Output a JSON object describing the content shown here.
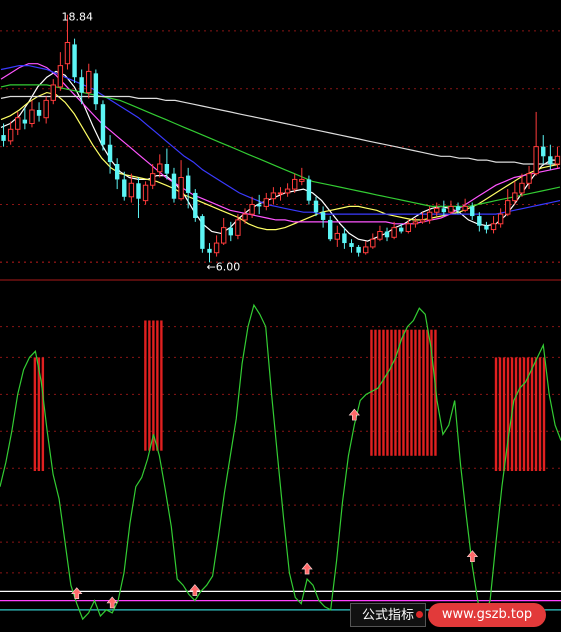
{
  "chart_data": [
    {
      "type": "candlestick",
      "annotations": {
        "high": "18.84",
        "low": "←6.00"
      },
      "price_range": [
        5.5,
        19.5
      ],
      "candles": [
        [
          12.6,
          12.3,
          13.2,
          12.0
        ],
        [
          12.3,
          12.9,
          13.3,
          12.1
        ],
        [
          12.9,
          13.5,
          13.8,
          12.6
        ],
        [
          13.4,
          13.2,
          14.0,
          12.9
        ],
        [
          13.2,
          13.9,
          14.4,
          13.0
        ],
        [
          13.9,
          13.6,
          14.3,
          13.3
        ],
        [
          13.5,
          14.4,
          14.6,
          13.2
        ],
        [
          14.4,
          15.2,
          15.5,
          14.2
        ],
        [
          15.1,
          16.2,
          16.9,
          14.9
        ],
        [
          16.3,
          17.4,
          18.84,
          16.0
        ],
        [
          17.3,
          15.6,
          17.6,
          15.3
        ],
        [
          15.6,
          14.8,
          16.0,
          14.2
        ],
        [
          14.8,
          15.9,
          16.3,
          14.5
        ],
        [
          15.8,
          14.2,
          16.0,
          13.9
        ],
        [
          14.2,
          12.1,
          14.4,
          11.8
        ],
        [
          12.1,
          11.2,
          12.6,
          10.6
        ],
        [
          11.1,
          10.3,
          11.4,
          9.8
        ],
        [
          10.3,
          9.4,
          10.7,
          9.2
        ],
        [
          9.4,
          10.1,
          10.6,
          9.1
        ],
        [
          10.1,
          9.3,
          10.4,
          8.3
        ],
        [
          9.2,
          10.0,
          10.2,
          9.0
        ],
        [
          10.0,
          10.6,
          11.1,
          9.8
        ],
        [
          10.7,
          11.1,
          11.6,
          10.4
        ],
        [
          11.1,
          10.6,
          11.9,
          10.3
        ],
        [
          10.6,
          9.3,
          10.9,
          9.1
        ],
        [
          9.3,
          10.4,
          11.3,
          9.2
        ],
        [
          10.5,
          9.6,
          10.9,
          8.8
        ],
        [
          9.6,
          8.3,
          9.8,
          8.1
        ],
        [
          8.4,
          6.7,
          8.5,
          6.5
        ],
        [
          6.7,
          6.5,
          7.0,
          6.0
        ],
        [
          6.5,
          7.0,
          7.4,
          6.3
        ],
        [
          7.0,
          7.8,
          8.3,
          6.9
        ],
        [
          7.8,
          7.4,
          8.1,
          7.1
        ],
        [
          7.4,
          8.2,
          8.5,
          7.2
        ],
        [
          8.2,
          8.5,
          8.8,
          8.0
        ],
        [
          8.5,
          9.0,
          9.4,
          8.3
        ],
        [
          9.0,
          8.9,
          9.5,
          8.5
        ],
        [
          8.9,
          9.3,
          9.6,
          8.7
        ],
        [
          9.3,
          9.6,
          9.9,
          9.0
        ],
        [
          9.6,
          9.6,
          9.9,
          9.2
        ],
        [
          9.6,
          9.8,
          10.1,
          9.4
        ],
        [
          9.8,
          10.3,
          10.6,
          9.6
        ],
        [
          10.2,
          10.3,
          10.9,
          10.0
        ],
        [
          10.3,
          9.2,
          10.5,
          9.0
        ],
        [
          9.2,
          8.6,
          9.4,
          8.4
        ],
        [
          8.6,
          8.2,
          8.9,
          7.8
        ],
        [
          8.2,
          7.2,
          8.4,
          7.1
        ],
        [
          7.2,
          7.5,
          7.9,
          6.8
        ],
        [
          7.5,
          7.0,
          7.8,
          6.7
        ],
        [
          7.0,
          6.8,
          7.2,
          6.5
        ],
        [
          6.8,
          6.5,
          6.9,
          6.3
        ],
        [
          6.5,
          6.8,
          7.1,
          6.4
        ],
        [
          6.8,
          7.2,
          7.5,
          6.7
        ],
        [
          7.2,
          7.6,
          7.9,
          7.1
        ],
        [
          7.6,
          7.3,
          7.8,
          7.1
        ],
        [
          7.3,
          7.8,
          8.1,
          7.2
        ],
        [
          7.8,
          7.6,
          8.0,
          7.5
        ],
        [
          7.6,
          8.0,
          8.2,
          7.5
        ],
        [
          8.0,
          8.1,
          8.3,
          7.8
        ],
        [
          8.1,
          8.2,
          8.6,
          8.0
        ],
        [
          8.2,
          8.6,
          8.9,
          8.0
        ],
        [
          8.6,
          8.8,
          9.1,
          8.4
        ],
        [
          8.8,
          8.6,
          9.2,
          8.4
        ],
        [
          8.6,
          8.9,
          9.2,
          8.5
        ],
        [
          8.9,
          8.7,
          9.1,
          8.5
        ],
        [
          8.7,
          8.9,
          9.3,
          8.6
        ],
        [
          8.9,
          8.4,
          9.1,
          8.2
        ],
        [
          8.4,
          7.9,
          8.6,
          7.6
        ],
        [
          7.9,
          7.7,
          8.1,
          7.5
        ],
        [
          7.7,
          8.0,
          8.4,
          7.5
        ],
        [
          8.0,
          8.5,
          8.8,
          7.8
        ],
        [
          8.5,
          9.2,
          9.8,
          8.4
        ],
        [
          9.2,
          9.6,
          10.2,
          9.0
        ],
        [
          9.6,
          10.1,
          10.6,
          9.4
        ],
        [
          10.1,
          10.6,
          11.0,
          9.8
        ],
        [
          10.6,
          12.0,
          13.8,
          10.5
        ],
        [
          12.0,
          11.5,
          12.6,
          11.1
        ],
        [
          11.5,
          11.1,
          12.1,
          10.8
        ],
        [
          11.1,
          11.5,
          12.0,
          10.9
        ]
      ],
      "moving_averages": [
        {
          "color": "#ffffff",
          "values": [
            13.0,
            13.2,
            13.6,
            14.3,
            15.1,
            15.6,
            15.9,
            15.7,
            15.1,
            14.2,
            13.1,
            12.1,
            11.3,
            10.7,
            10.4,
            10.3,
            10.3,
            10.5,
            10.5,
            10.1,
            9.5,
            8.7,
            8.0,
            7.6,
            7.5,
            7.8,
            8.3,
            8.7,
            9.0,
            9.2,
            9.4,
            9.6,
            9.7,
            9.8,
            9.6,
            9.2,
            8.6,
            8.0,
            7.5,
            7.2,
            7.1,
            7.3,
            7.5,
            7.8,
            8.0,
            8.3,
            8.6,
            8.8,
            8.9,
            8.8,
            8.6,
            8.2,
            8.0,
            7.9,
            8.0,
            8.4,
            9.0,
            9.7,
            10.4,
            11.0,
            11.3,
            11.3
          ]
        },
        {
          "color": "#ffff66",
          "values": [
            13.4,
            13.6,
            13.9,
            14.3,
            14.6,
            14.8,
            14.7,
            14.3,
            13.7,
            12.9,
            12.1,
            11.4,
            10.9,
            10.6,
            10.5,
            10.4,
            10.3,
            10.2,
            10.0,
            9.8,
            9.5,
            9.3,
            9.1,
            8.9,
            8.7,
            8.5,
            8.3,
            8.0,
            7.8,
            7.7,
            7.7,
            7.8,
            8.0,
            8.2,
            8.4,
            8.6,
            8.7,
            8.8,
            8.9,
            8.9,
            8.8,
            8.7,
            8.5,
            8.4,
            8.3,
            8.2,
            8.2,
            8.3,
            8.4,
            8.5,
            8.6,
            8.8,
            9.0,
            9.3,
            9.6,
            9.9,
            10.2,
            10.5,
            10.7,
            10.9,
            11.0,
            11.1
          ]
        },
        {
          "color": "#ff55ff",
          "values": [
            15.5,
            15.8,
            16.1,
            16.3,
            16.3,
            16.1,
            15.7,
            15.2,
            14.7,
            14.2,
            13.7,
            13.2,
            12.8,
            12.4,
            12.0,
            11.6,
            11.2,
            10.8,
            10.4,
            10.1,
            9.8,
            9.5,
            9.3,
            9.1,
            8.9,
            8.7,
            8.6,
            8.5,
            8.4,
            8.3,
            8.2,
            8.2,
            8.1,
            8.1,
            8.1,
            8.1,
            8.1,
            8.1,
            8.1,
            8.1,
            8.1,
            8.1,
            8.1,
            8.0,
            8.0,
            8.0,
            8.1,
            8.2,
            8.3,
            8.5,
            8.8,
            9.1,
            9.4,
            9.7,
            10.0,
            10.2,
            10.4,
            10.5,
            10.6,
            10.7,
            10.8,
            10.9
          ]
        },
        {
          "color": "#3a3aff",
          "values": [
            16.0,
            16.1,
            16.2,
            16.2,
            16.1,
            16.0,
            15.8,
            15.6,
            15.4,
            15.2,
            15.0,
            14.7,
            14.4,
            14.1,
            13.8,
            13.5,
            13.1,
            12.7,
            12.3,
            11.9,
            11.5,
            11.2,
            10.8,
            10.5,
            10.2,
            9.9,
            9.6,
            9.4,
            9.2,
            9.0,
            8.9,
            8.8,
            8.7,
            8.6,
            8.6,
            8.5,
            8.5,
            8.5,
            8.5,
            8.5,
            8.5,
            8.5,
            8.5,
            8.5,
            8.5,
            8.5,
            8.5,
            8.5,
            8.5,
            8.5,
            8.5,
            8.5,
            8.5,
            8.5,
            8.5,
            8.6,
            8.7,
            8.8,
            8.9,
            9.0,
            9.1,
            9.2
          ]
        },
        {
          "color": "#33cc33",
          "values": [
            15.1,
            15.2,
            15.2,
            15.2,
            15.2,
            15.2,
            15.1,
            15.0,
            14.9,
            14.8,
            14.7,
            14.6,
            14.5,
            14.4,
            14.2,
            14.0,
            13.8,
            13.6,
            13.4,
            13.2,
            13.0,
            12.8,
            12.6,
            12.4,
            12.2,
            12.0,
            11.8,
            11.6,
            11.4,
            11.2,
            11.0,
            10.8,
            10.6,
            10.4,
            10.2,
            10.1,
            10.0,
            9.9,
            9.8,
            9.7,
            9.6,
            9.5,
            9.4,
            9.3,
            9.2,
            9.1,
            9.0,
            8.9,
            8.9,
            8.9,
            8.9,
            8.9,
            9.0,
            9.1,
            9.2,
            9.3,
            9.4,
            9.5,
            9.6,
            9.7,
            9.8,
            9.9
          ]
        },
        {
          "color": "#dddddd",
          "values": [
            14.5,
            14.6,
            14.6,
            14.6,
            14.6,
            14.6,
            14.6,
            14.6,
            14.6,
            14.6,
            14.6,
            14.6,
            14.6,
            14.6,
            14.6,
            14.5,
            14.5,
            14.5,
            14.4,
            14.4,
            14.3,
            14.2,
            14.1,
            14.0,
            13.9,
            13.8,
            13.7,
            13.6,
            13.5,
            13.4,
            13.3,
            13.2,
            13.1,
            13.0,
            12.9,
            12.8,
            12.7,
            12.6,
            12.5,
            12.4,
            12.3,
            12.2,
            12.1,
            12.0,
            11.9,
            11.8,
            11.7,
            11.6,
            11.5,
            11.5,
            11.4,
            11.4,
            11.3,
            11.3,
            11.2,
            11.2,
            11.2,
            11.1,
            11.1,
            11.1,
            11.1,
            11.1
          ]
        }
      ]
    },
    {
      "type": "line",
      "series": [
        {
          "color": "#33cc33",
          "values": [
            40,
            48,
            58,
            70,
            78,
            82,
            84,
            74,
            58,
            44,
            36,
            22,
            8,
            2,
            -3,
            -1,
            3,
            -2,
            0,
            -1,
            3,
            12,
            28,
            40,
            43,
            49,
            57,
            50,
            39,
            27,
            10,
            8,
            5,
            3,
            6,
            8,
            11,
            24,
            38,
            50,
            62,
            80,
            92,
            99,
            96,
            92,
            70,
            50,
            30,
            12,
            4,
            2,
            10,
            8,
            3,
            1,
            0,
            16,
            35,
            50,
            60,
            68,
            70,
            71,
            72,
            75,
            78,
            82,
            88,
            92,
            94,
            98,
            96,
            85,
            68,
            57,
            60,
            68,
            47,
            30,
            14,
            2,
            -2,
            3,
            22,
            40,
            55,
            68,
            72,
            74,
            78,
            82,
            86,
            70,
            60,
            55
          ]
        }
      ],
      "y_range": [
        -2,
        100
      ],
      "bars": [
        {
          "from": 0.45,
          "to": 0.68,
          "top": 82
        },
        {
          "from": 0.8,
          "to": 0.96,
          "top": 94
        },
        {
          "from": 0.56,
          "to": 0.98,
          "top": 91
        },
        {
          "from": 0.56,
          "to": 0.92,
          "top": 82
        }
      ],
      "arrows": [
        0.14,
        0.2,
        0.35,
        0.55,
        0.63,
        0.84
      ],
      "reference_lines": [
        {
          "color": "#ffffff",
          "value": 6
        },
        {
          "color": "#ff40ff",
          "value": 3
        },
        {
          "color": "#33cccc",
          "value": 0
        }
      ]
    }
  ],
  "watermark": {
    "left": "公式指标",
    "right": "www.gszb.top"
  }
}
